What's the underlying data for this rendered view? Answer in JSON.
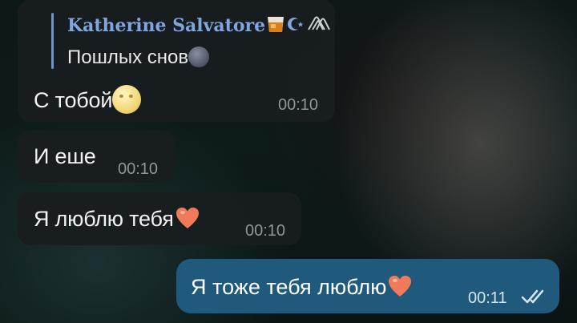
{
  "reply": {
    "author": "Katherine Salvatore",
    "text": "Пошлых снов"
  },
  "messages": [
    {
      "text": "С тобой",
      "time": "00:10"
    },
    {
      "text": "И еше",
      "time": "00:10"
    },
    {
      "text": "Я люблю тебя",
      "time": "00:10"
    },
    {
      "text": "Я тоже тебя люблю",
      "time": "00:11"
    }
  ],
  "icons": {
    "reply_name_emojis": [
      "whisky-glass-icon",
      "star-and-crescent-icon",
      "paperclip-icon"
    ],
    "new_moon": "new-moon-face-icon",
    "full_moon": "full-moon-face-icon",
    "heart": "heart-icon",
    "read_status": "double-check-icon"
  },
  "colors": {
    "reply_accent": "#7fa6df",
    "incoming_bubble": "#181e20",
    "outgoing_bubble": "#1f5a7d",
    "heart": "#f07a5a"
  }
}
